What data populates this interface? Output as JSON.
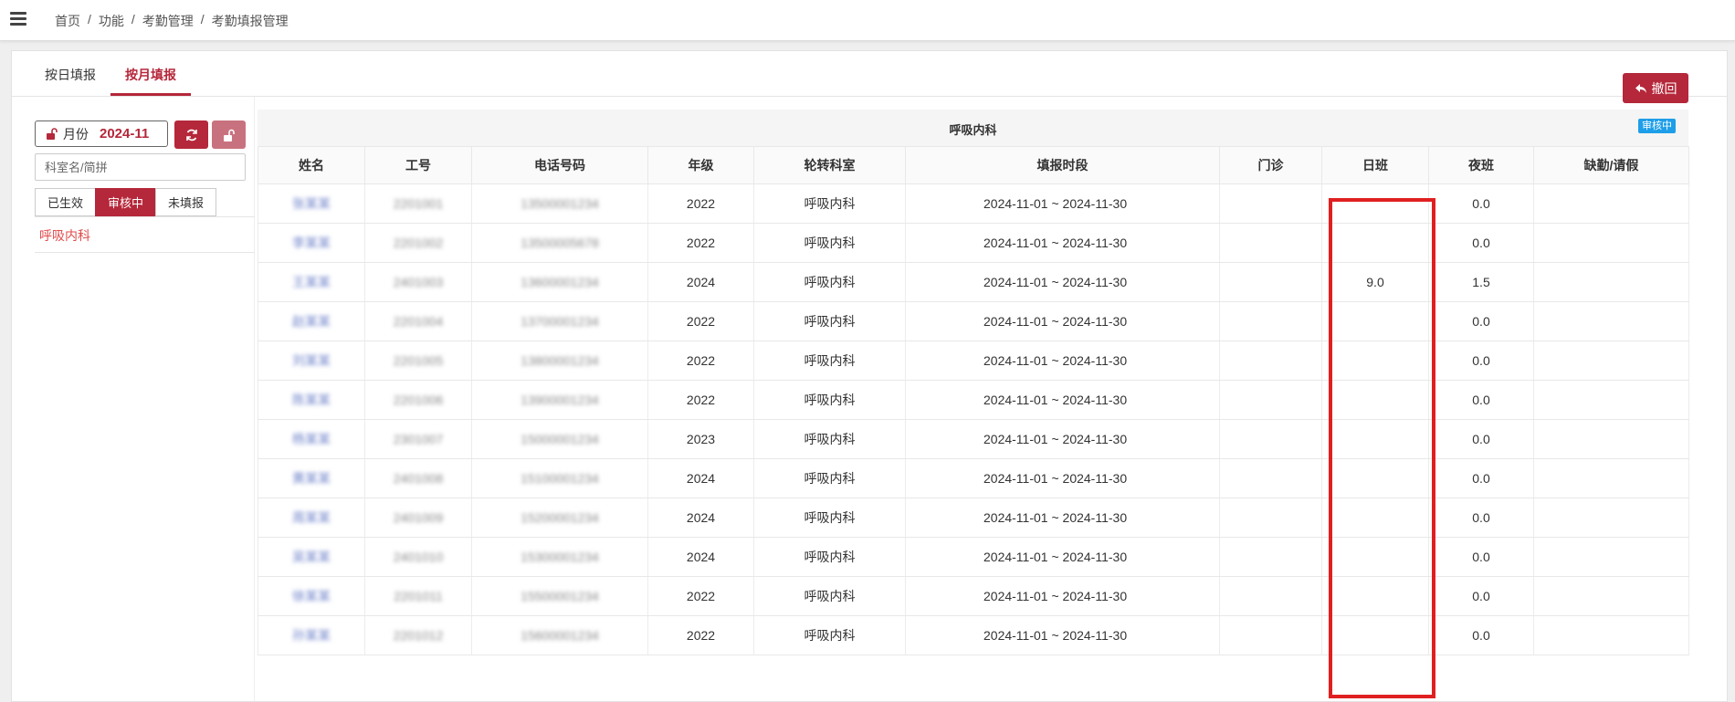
{
  "breadcrumb": [
    "首页",
    "功能",
    "考勤管理",
    "考勤填报管理"
  ],
  "tabs": [
    {
      "label": "按日填报",
      "active": false
    },
    {
      "label": "按月填报",
      "active": true
    }
  ],
  "filters": {
    "month_label": "月份",
    "month_value": "2024-11",
    "search_placeholder": "科室名/简拼",
    "status_tabs": [
      {
        "label": "已生效",
        "active": false
      },
      {
        "label": "审核中",
        "active": true
      },
      {
        "label": "未填报",
        "active": false
      }
    ],
    "departments": [
      "呼吸内科"
    ]
  },
  "actions": {
    "revoke_label": "撤回"
  },
  "table": {
    "department_title": "呼吸内科",
    "status_badge": "审核中",
    "columns": [
      "姓名",
      "工号",
      "电话号码",
      "年级",
      "轮转科室",
      "填报时段",
      "门诊",
      "日班",
      "夜班",
      "缺勤/请假"
    ],
    "rows": [
      {
        "name": "张某某",
        "id": "2201001",
        "phone": "13500001234",
        "grade": "2022",
        "dept": "呼吸内科",
        "period": "2024-11-01 ~ 2024-11-30",
        "clinic": "",
        "day": "",
        "night": "0.0",
        "absence": ""
      },
      {
        "name": "李某某",
        "id": "2201002",
        "phone": "13500005678",
        "grade": "2022",
        "dept": "呼吸内科",
        "period": "2024-11-01 ~ 2024-11-30",
        "clinic": "",
        "day": "",
        "night": "0.0",
        "absence": ""
      },
      {
        "name": "王某某",
        "id": "2401003",
        "phone": "13600001234",
        "grade": "2024",
        "dept": "呼吸内科",
        "period": "2024-11-01 ~ 2024-11-30",
        "clinic": "",
        "day": "9.0",
        "night": "1.5",
        "absence": ""
      },
      {
        "name": "赵某某",
        "id": "2201004",
        "phone": "13700001234",
        "grade": "2022",
        "dept": "呼吸内科",
        "period": "2024-11-01 ~ 2024-11-30",
        "clinic": "",
        "day": "",
        "night": "0.0",
        "absence": ""
      },
      {
        "name": "刘某某",
        "id": "2201005",
        "phone": "13800001234",
        "grade": "2022",
        "dept": "呼吸内科",
        "period": "2024-11-01 ~ 2024-11-30",
        "clinic": "",
        "day": "",
        "night": "0.0",
        "absence": ""
      },
      {
        "name": "陈某某",
        "id": "2201006",
        "phone": "13900001234",
        "grade": "2022",
        "dept": "呼吸内科",
        "period": "2024-11-01 ~ 2024-11-30",
        "clinic": "",
        "day": "",
        "night": "0.0",
        "absence": ""
      },
      {
        "name": "杨某某",
        "id": "2301007",
        "phone": "15000001234",
        "grade": "2023",
        "dept": "呼吸内科",
        "period": "2024-11-01 ~ 2024-11-30",
        "clinic": "",
        "day": "",
        "night": "0.0",
        "absence": ""
      },
      {
        "name": "黄某某",
        "id": "2401008",
        "phone": "15100001234",
        "grade": "2024",
        "dept": "呼吸内科",
        "period": "2024-11-01 ~ 2024-11-30",
        "clinic": "",
        "day": "",
        "night": "0.0",
        "absence": ""
      },
      {
        "name": "周某某",
        "id": "2401009",
        "phone": "15200001234",
        "grade": "2024",
        "dept": "呼吸内科",
        "period": "2024-11-01 ~ 2024-11-30",
        "clinic": "",
        "day": "",
        "night": "0.0",
        "absence": ""
      },
      {
        "name": "吴某某",
        "id": "2401010",
        "phone": "15300001234",
        "grade": "2024",
        "dept": "呼吸内科",
        "period": "2024-11-01 ~ 2024-11-30",
        "clinic": "",
        "day": "",
        "night": "0.0",
        "absence": ""
      },
      {
        "name": "徐某某",
        "id": "2201011",
        "phone": "15500001234",
        "grade": "2022",
        "dept": "呼吸内科",
        "period": "2024-11-01 ~ 2024-11-30",
        "clinic": "",
        "day": "",
        "night": "0.0",
        "absence": ""
      },
      {
        "name": "孙某某",
        "id": "2201012",
        "phone": "15600001234",
        "grade": "2022",
        "dept": "呼吸内科",
        "period": "2024-11-01 ~ 2024-11-30",
        "clinic": "",
        "day": "",
        "night": "0.0",
        "absence": ""
      }
    ]
  },
  "colors": {
    "accent": "#b5273a",
    "badge": "#1e9ee8",
    "highlight": "#e02020"
  }
}
